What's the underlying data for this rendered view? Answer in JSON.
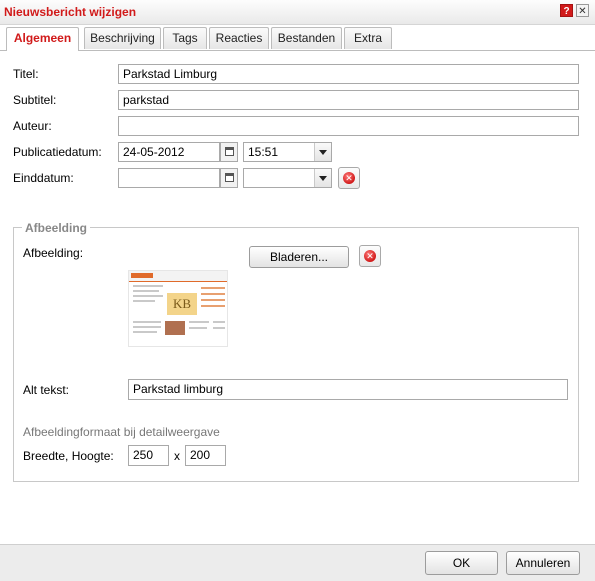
{
  "dialog": {
    "title": "Nieuwsbericht wijzigen",
    "help_glyph": "?",
    "close_glyph": "✕"
  },
  "tabs": [
    {
      "label": "Algemeen",
      "active": true
    },
    {
      "label": "Beschrijving",
      "active": false
    },
    {
      "label": "Tags",
      "active": false
    },
    {
      "label": "Reacties",
      "active": false
    },
    {
      "label": "Bestanden",
      "active": false
    },
    {
      "label": "Extra",
      "active": false
    }
  ],
  "form": {
    "titel": {
      "label": "Titel:",
      "value": "Parkstad Limburg"
    },
    "subtitel": {
      "label": "Subtitel:",
      "value": "parkstad"
    },
    "auteur": {
      "label": "Auteur:",
      "value": ""
    },
    "publicatiedatum": {
      "label": "Publicatiedatum:",
      "date": "24-05-2012",
      "time": "15:51"
    },
    "einddatum": {
      "label": "Einddatum:",
      "date": "",
      "time": ""
    }
  },
  "afbeelding": {
    "legend": "Afbeelding",
    "label": "Afbeelding:",
    "browse_label": "Bladeren...",
    "thumbnail_text": "KB",
    "alt_label": "Alt tekst:",
    "alt_value": "Parkstad limburg",
    "format_hint": "Afbeeldingformaat bij detailweergave",
    "size_label": "Breedte, Hoogte:",
    "width": "250",
    "separator": "x",
    "height": "200"
  },
  "footer": {
    "ok_label": "OK",
    "cancel_label": "Annuleren"
  },
  "colors": {
    "accent": "#d11a1a",
    "hint": "#777777"
  }
}
